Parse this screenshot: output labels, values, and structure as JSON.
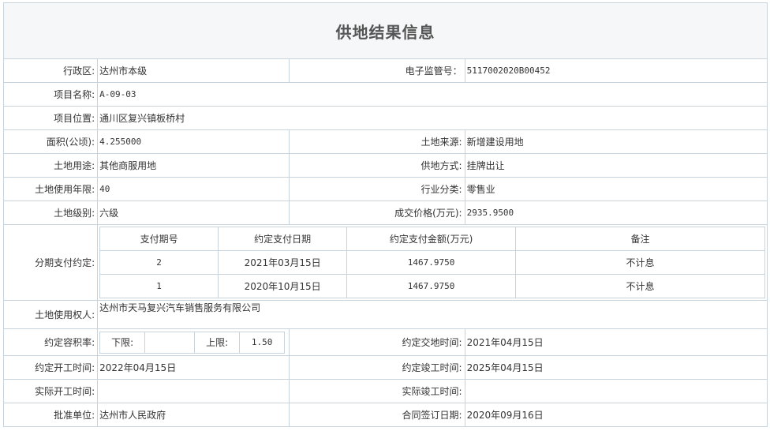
{
  "title": "供地结果信息",
  "fields": {
    "district": {
      "label": "行政区:",
      "value": "达州市本级"
    },
    "supervision_no": {
      "label": "电子监管号：",
      "value": "5117002020B00452"
    },
    "project_name": {
      "label": "项目名称:",
      "value": "A-09-03"
    },
    "project_location": {
      "label": "项目位置:",
      "value": "通川区复兴镇板桥村"
    },
    "area": {
      "label": "面积(公顷):",
      "value": "4.255000"
    },
    "land_source": {
      "label": "土地来源:",
      "value": "新增建设用地"
    },
    "land_use": {
      "label": "土地用途:",
      "value": "其他商服用地"
    },
    "supply_method": {
      "label": "供地方式:",
      "value": "挂牌出让"
    },
    "use_years": {
      "label": "土地使用年限:",
      "value": "40"
    },
    "industry": {
      "label": "行业分类:",
      "value": "零售业"
    },
    "land_grade": {
      "label": "土地级别:",
      "value": "六级"
    },
    "deal_price": {
      "label": "成交价格(万元):",
      "value": "2935.9500"
    },
    "installment_label": "分期支付约定:",
    "land_user": {
      "label": "土地使用权人:",
      "value": "达州市天马复兴汽车销售服务有限公司"
    },
    "far": {
      "label": "约定容积率:",
      "lower_label": "下限:",
      "lower_value": "",
      "upper_label": "上限:",
      "upper_value": "1.50"
    },
    "delivery_time": {
      "label": "约定交地时间:",
      "value": "2021年04月15日"
    },
    "start_time": {
      "label": "约定开工时间:",
      "value": "2022年04月15日"
    },
    "completion_time": {
      "label": "约定竣工时间:",
      "value": "2025年04月15日"
    },
    "actual_start": {
      "label": "实际开工时间:",
      "value": ""
    },
    "actual_completion": {
      "label": "实际竣工时间:",
      "value": ""
    },
    "approval_unit": {
      "label": "批准单位:",
      "value": "达州市人民政府"
    },
    "contract_date": {
      "label": "合同签订日期:",
      "value": "2020年09月16日"
    }
  },
  "installments": {
    "headers": [
      "支付期号",
      "约定支付日期",
      "约定支付金额(万元)",
      "备注"
    ],
    "rows": [
      [
        "2",
        "2021年03月15日",
        "1467.9750",
        "不计息"
      ],
      [
        "1",
        "2020年10月15日",
        "1467.9750",
        "不计息"
      ]
    ]
  }
}
